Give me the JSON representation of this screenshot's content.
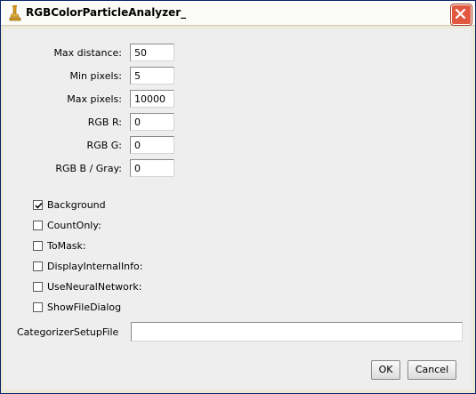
{
  "window": {
    "title": "RGBColorParticleAnalyzer_"
  },
  "fields": [
    {
      "label": "Max distance:",
      "value": "50"
    },
    {
      "label": "Min pixels:",
      "value": "5"
    },
    {
      "label": "Max pixels:",
      "value": "10000"
    },
    {
      "label": "RGB R:",
      "value": "0"
    },
    {
      "label": "RGB G:",
      "value": "0"
    },
    {
      "label": "RGB B / Gray:",
      "value": "0"
    }
  ],
  "checkboxes": [
    {
      "label": "Background",
      "checked": true
    },
    {
      "label": "CountOnly:",
      "checked": false
    },
    {
      "label": "ToMask:",
      "checked": false
    },
    {
      "label": "DisplayInternalInfo:",
      "checked": false
    },
    {
      "label": "UseNeuralNetwork:",
      "checked": false
    },
    {
      "label": "ShowFileDialog",
      "checked": false
    }
  ],
  "file_field": {
    "label": "CategorizerSetupFile",
    "value": ""
  },
  "buttons": {
    "ok": "OK",
    "cancel": "Cancel"
  },
  "icons": {
    "title": "microscope-icon",
    "close": "close-icon"
  }
}
